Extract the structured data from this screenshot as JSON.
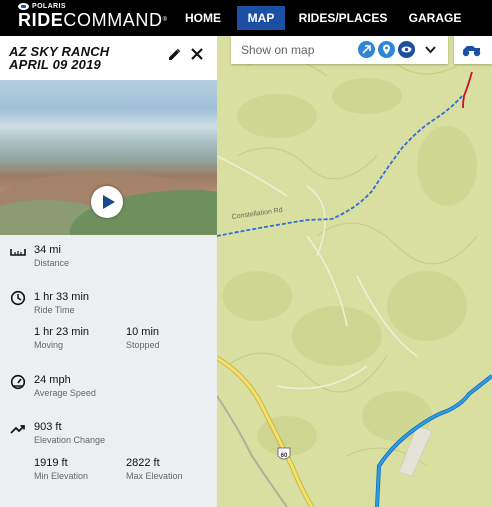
{
  "brand": {
    "top": "POLARIS",
    "main_bold": "RIDE",
    "main_light": "COMMAND",
    "mark": "®"
  },
  "nav": [
    {
      "label": "HOME",
      "active": false
    },
    {
      "label": "MAP",
      "active": true
    },
    {
      "label": "RIDES/PLACES",
      "active": false
    },
    {
      "label": "GARAGE",
      "active": false
    }
  ],
  "ride": {
    "title": "AZ SKY RANCH",
    "date": "APRIL 09 2019"
  },
  "stats": {
    "distance": {
      "value": "34 mi",
      "label": "Distance"
    },
    "ride_time": {
      "value": "1 hr 33 min",
      "label": "Ride Time"
    },
    "moving": {
      "value": "1 hr 23 min",
      "label": "Moving"
    },
    "stopped": {
      "value": "10 min",
      "label": "Stopped"
    },
    "avg_speed": {
      "value": "24 mph",
      "label": "Average Speed"
    },
    "elev_change": {
      "value": "903 ft",
      "label": "Elevation Change"
    },
    "min_elev": {
      "value": "1919 ft",
      "label": "Min Elevation"
    },
    "max_elev": {
      "value": "2822 ft",
      "label": "Max Elevation"
    }
  },
  "map": {
    "search_placeholder": "Show on map",
    "road_label": "Constellation Rd",
    "highway_shield": "60",
    "icons": [
      "navigate-icon",
      "pin-icon",
      "eye-icon",
      "chevron-down-icon",
      "atv-icon"
    ]
  },
  "colors": {
    "accent": "#1a4fa3",
    "route_blue": "#2f8fd8",
    "track_red": "#c8102e",
    "map_bg": "#d9dfa0"
  }
}
